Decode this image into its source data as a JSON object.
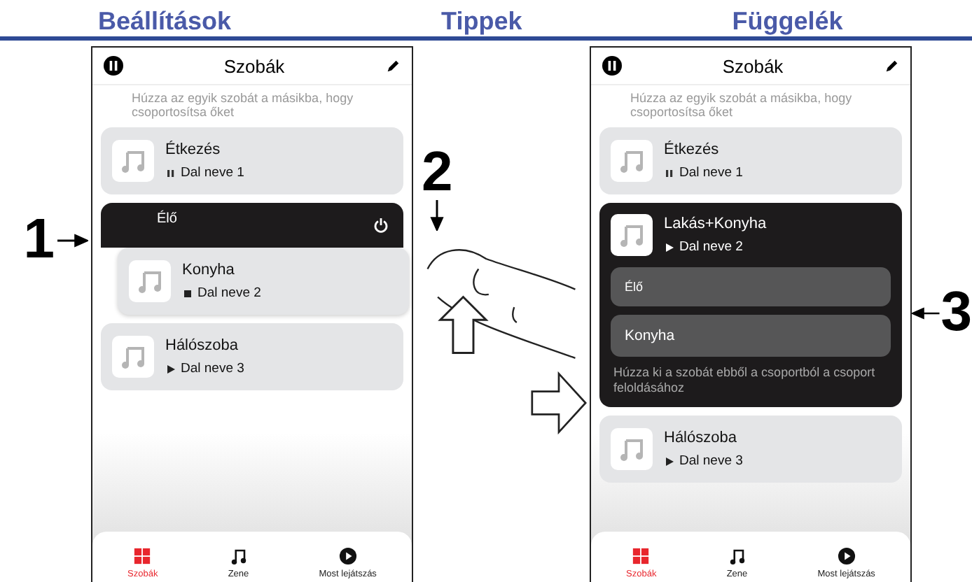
{
  "header_tabs": [
    {
      "label": "Beállítások"
    },
    {
      "label": "Tippek"
    },
    {
      "label": "Függelék"
    }
  ],
  "steps": [
    {
      "label": "1"
    },
    {
      "label": "2"
    },
    {
      "label": "3"
    }
  ],
  "phones": [
    {
      "title": "Szobák",
      "hint": "Húzza az egyik szobát a másikba, hogy csoportosítsa őket",
      "rooms": [
        {
          "kind": "room",
          "name": "Étkezés",
          "song": "Dal neve 1",
          "indicator": {
            "kind": "paused"
          }
        },
        {
          "kind": "active",
          "name": "Élő",
          "dragged": {
            "name": "Konyha",
            "song": "Dal neve 2",
            "indicator": {
              "kind": "stopped"
            }
          }
        },
        {
          "kind": "room",
          "name": "Hálószoba",
          "song": "Dal neve 3",
          "indicator": {
            "kind": "playing"
          }
        }
      ],
      "nav": [
        {
          "label": "Szobák",
          "selected": true
        },
        {
          "label": "Zene",
          "selected": false
        },
        {
          "label": "Most lejátszás",
          "selected": false
        }
      ]
    },
    {
      "title": "Szobák",
      "hint": "Húzza az egyik szobát a másikba, hogy csoportosítsa őket",
      "rooms": [
        {
          "kind": "room",
          "name": "Étkezés",
          "song": "Dal neve 1",
          "indicator": {
            "kind": "paused"
          }
        },
        {
          "kind": "group",
          "name": "Lakás+Konyha",
          "song": "Dal neve 2",
          "indicator": {
            "kind": "playing"
          },
          "members": [
            {
              "name": "Élő"
            },
            {
              "name": "Konyha"
            }
          ],
          "hint": "Húzza ki a szobát ebből a csoportból a csoport feloldásához"
        },
        {
          "kind": "room",
          "name": "Hálószoba",
          "song": "Dal neve 3",
          "indicator": {
            "kind": "playing"
          }
        }
      ],
      "nav": [
        {
          "label": "Szobák",
          "selected": true
        },
        {
          "label": "Zene",
          "selected": false
        },
        {
          "label": "Most lejátszás",
          "selected": false
        }
      ]
    }
  ]
}
